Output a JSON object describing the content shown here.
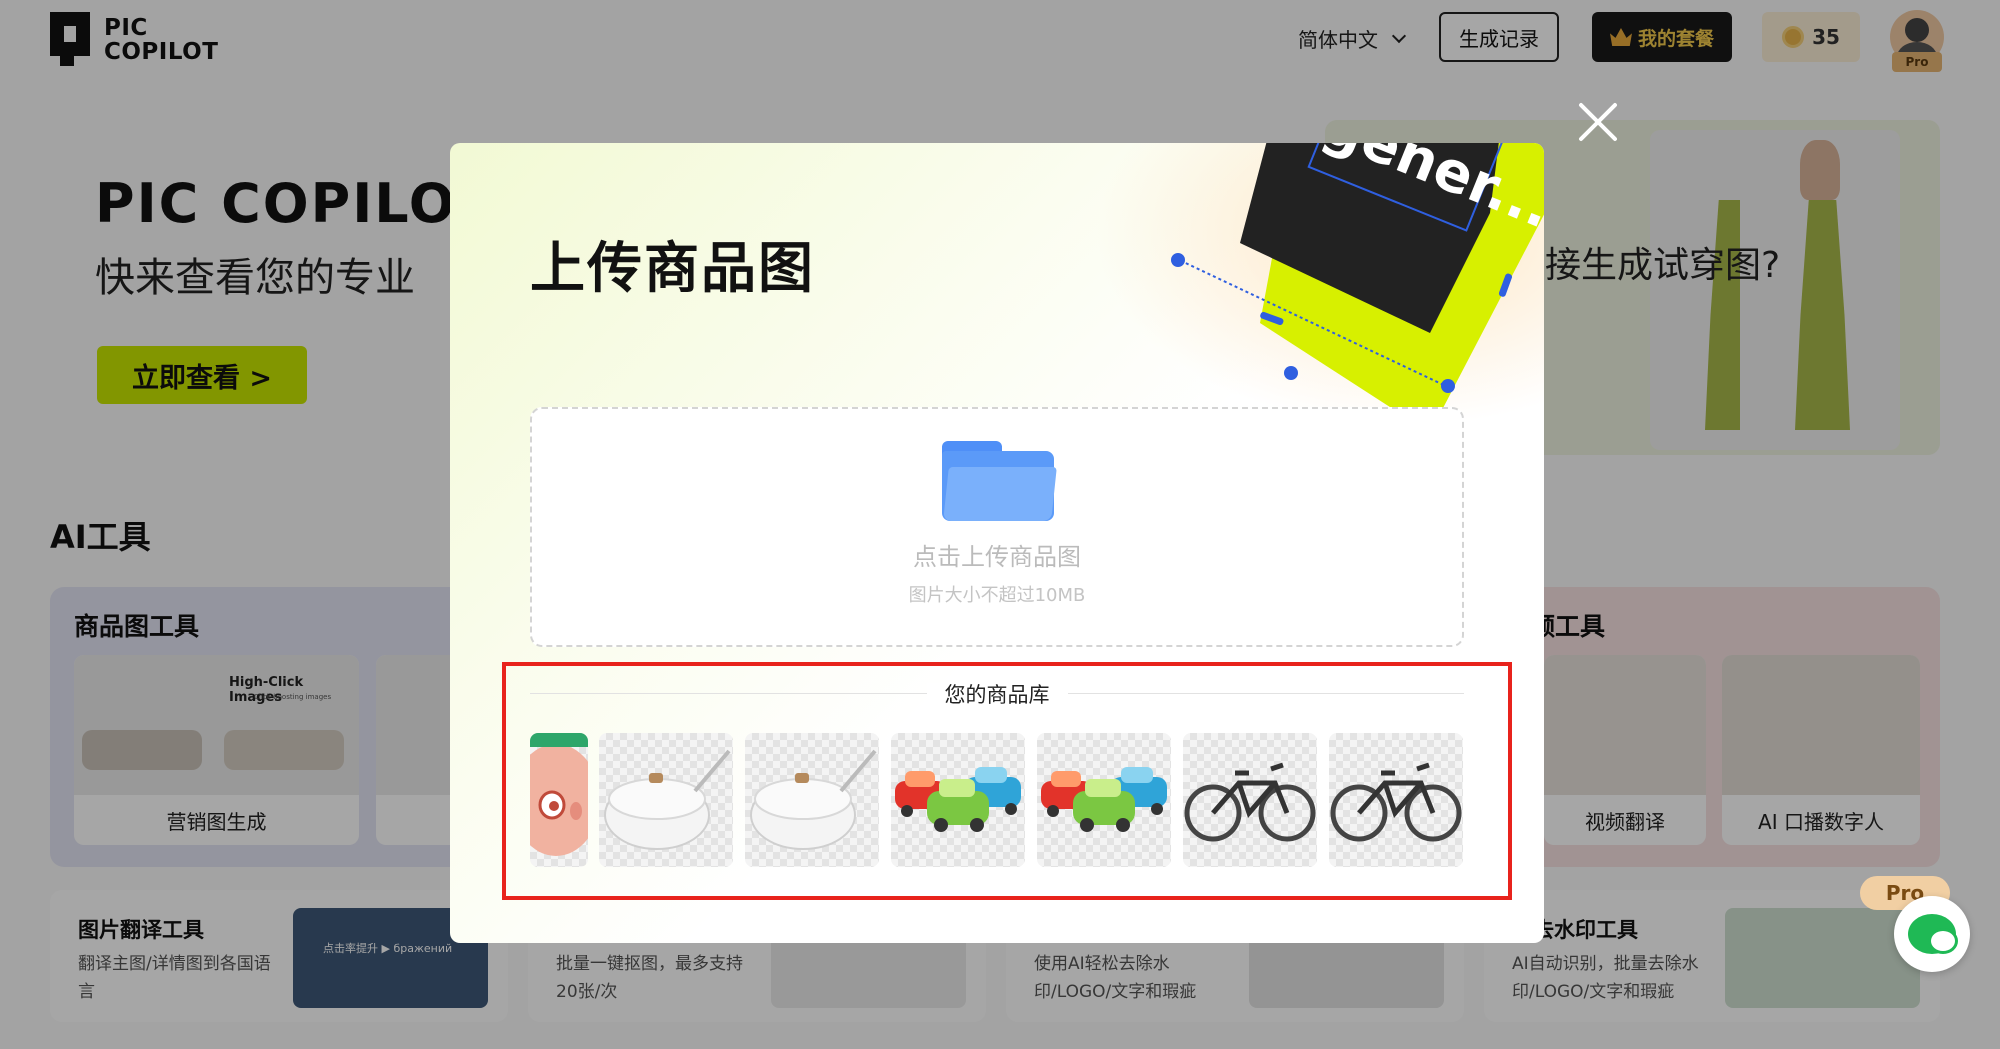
{
  "header": {
    "logo_line1": "PIC",
    "logo_line2": "COPILOT",
    "language": "简体中文",
    "history_label": "生成记录",
    "plan_label": "我的套餐",
    "coins": "35",
    "pro_badge": "Pro"
  },
  "hero": {
    "title": "PIC COPILOT",
    "subtitle": "快来查看您的专业",
    "cta_label": "立即查看 >",
    "right_text": "接生成试穿图?"
  },
  "ai_tools": {
    "section_title": "AI工具",
    "product_panel_title": "商品图工具",
    "card1_label": "营销图生成",
    "card1_overlay_title": "High-Click Images",
    "card1_overlay_sub": "Click-boosting images",
    "video_panel_title": "频工具",
    "video_card1_label": "视频翻译",
    "video_card2_label": "AI 口播数字人"
  },
  "bottom_cards": [
    {
      "title": "图片翻译工具",
      "desc": "翻译主图/详情图到各国语言",
      "img_text": "点击率提升 ▶ бражений"
    },
    {
      "title": "",
      "desc": "批量一键抠图，最多支持20张/次"
    },
    {
      "title": "",
      "desc": "使用AI轻松去除水印/LOGO/文字和瑕疵"
    },
    {
      "title": "量去水印工具",
      "desc": "AI自动识别，批量去除水印/LOGO/文字和瑕疵"
    }
  ],
  "bottom_pro_tag": "Pro",
  "modal": {
    "title": "上传商品图",
    "deco_text": "gener...",
    "upload_main": "点击上传商品图",
    "upload_hint": "图片大小不超过10MB",
    "library_title": "您的商品库",
    "library_items": [
      {
        "icon": "pink-character-icon"
      },
      {
        "icon": "white-pan-icon"
      },
      {
        "icon": "white-pan-icon"
      },
      {
        "icon": "toy-cars-icon"
      },
      {
        "icon": "toy-cars-icon"
      },
      {
        "icon": "bicycle-icon"
      },
      {
        "icon": "bicycle-icon"
      }
    ]
  },
  "colors": {
    "accent_lime": "#c8e600",
    "highlight_red": "#e8231c",
    "folder_blue": "#5b9af8"
  }
}
